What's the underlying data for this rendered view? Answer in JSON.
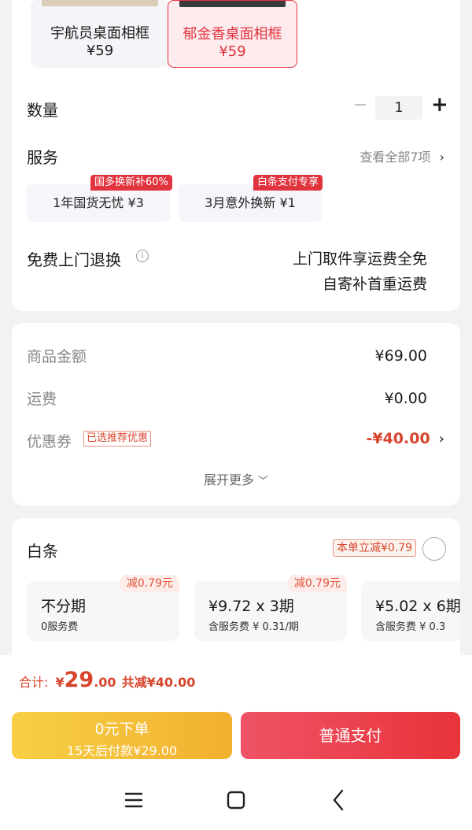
{
  "variants": [
    {
      "name": "宇航员桌面相框",
      "price": "¥59"
    },
    {
      "name": "郁金香桌面相框",
      "price": "¥59"
    }
  ],
  "quantity": {
    "label": "数量",
    "value": "1",
    "minus": "−",
    "plus": "+"
  },
  "service": {
    "label": "服务",
    "view_all": "查看全部7项",
    "items": [
      {
        "label": "1年国货无忧 ¥3",
        "tag": "国多换新补60%"
      },
      {
        "label": "3月意外换新 ¥1",
        "tag": "白条支付专享"
      }
    ]
  },
  "free_return": {
    "label": "免费上门退换",
    "line1": "上门取件享运费全免",
    "line2": "自寄补首重运费"
  },
  "fees": {
    "goods_label": "商品金额",
    "goods_value": "¥69.00",
    "shipping_label": "运费",
    "shipping_value": "¥0.00",
    "coupon_label": "优惠券",
    "coupon_badge": "已选推荐优惠",
    "coupon_value": "-¥40.00",
    "expand": "展开更多"
  },
  "baitiao": {
    "label": "白条",
    "discount_badge": "本单立减¥0.79",
    "options": [
      {
        "main": "不分期",
        "sub": "0服务费",
        "cut": "减0.79元"
      },
      {
        "main": "¥9.72 x 3期",
        "sub": "含服务费 ¥ 0.31/期",
        "cut": "减0.79元"
      },
      {
        "main": "¥5.02 x 6期",
        "sub": "含服务费 ¥ 0.3"
      }
    ]
  },
  "total": {
    "label": "合计:",
    "currency": "¥",
    "integer": "29",
    "decimal": ".00",
    "saved": "共减¥40.00"
  },
  "actions": {
    "zero_order": "0元下单",
    "zero_order_sub": "15天后付款¥29.00",
    "pay": "普通支付"
  },
  "colors": {
    "accent_red": "#e2343f",
    "price_red": "#d8452d",
    "gold_start": "#f7cf45",
    "gold_end": "#f2b030",
    "pay_start": "#ef5366",
    "pay_end": "#e8333a"
  },
  "nav_icons": [
    "menu-icon",
    "home-icon",
    "back-icon"
  ]
}
